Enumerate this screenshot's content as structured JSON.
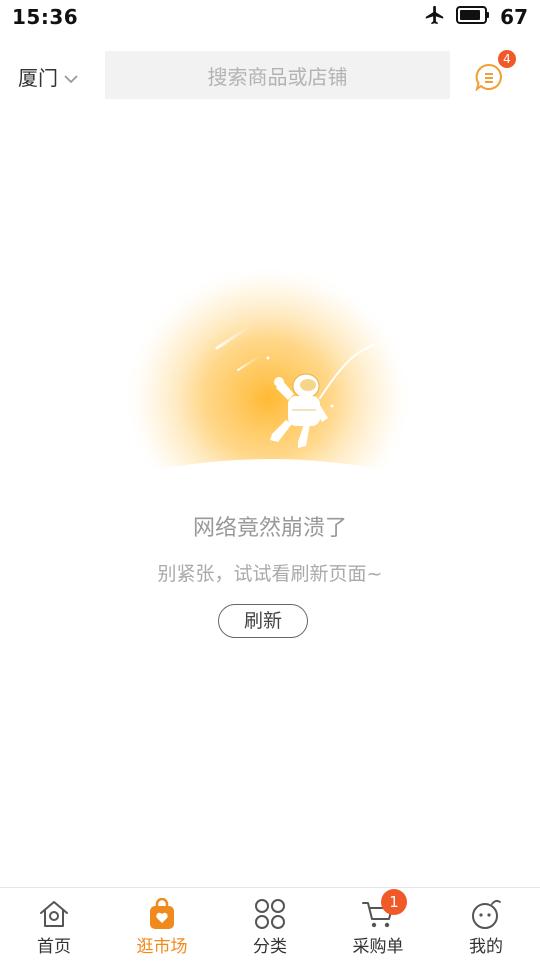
{
  "status_bar": {
    "time": "15:36",
    "battery": "67"
  },
  "header": {
    "city": "厦门",
    "search_placeholder": "搜索商品或店铺",
    "message_badge": "4"
  },
  "error": {
    "title": "网络竟然崩溃了",
    "subtitle": "别紧张，试试看刷新页面~",
    "refresh_label": "刷新"
  },
  "bottom_nav": {
    "tabs": [
      {
        "label": "首页",
        "icon": "home-icon",
        "active": false
      },
      {
        "label": "逛市场",
        "icon": "shopping-bag-icon",
        "active": true
      },
      {
        "label": "分类",
        "icon": "category-icon",
        "active": false
      },
      {
        "label": "采购单",
        "icon": "cart-icon",
        "active": false,
        "badge": "1"
      },
      {
        "label": "我的",
        "icon": "profile-icon",
        "active": false
      }
    ]
  },
  "colors": {
    "accent": "#f08a1c",
    "badge": "#f05a28",
    "glow": "#ffb629"
  }
}
